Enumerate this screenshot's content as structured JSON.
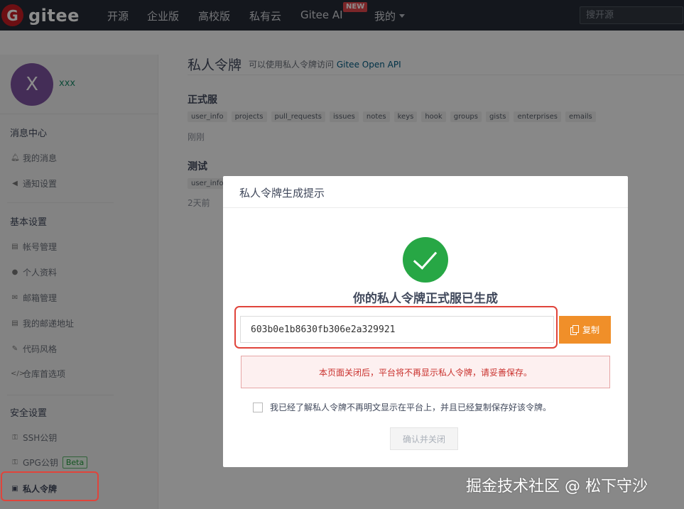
{
  "app": {
    "logo_letter": "G",
    "logo_text": "gitee",
    "brand_color": "#c71d23"
  },
  "nav": {
    "items": [
      "开源",
      "企业版",
      "高校版",
      "私有云",
      "Gitee AI",
      "我的"
    ],
    "new_badge": "NEW",
    "search_placeholder": "搜开源"
  },
  "sidebar": {
    "avatar_letter": "X",
    "username": "xxx",
    "sections": [
      {
        "heading": "消息中心",
        "items": [
          {
            "label": "我的消息",
            "icon": "bell-icon"
          },
          {
            "label": "通知设置",
            "icon": "volume-icon"
          }
        ]
      },
      {
        "heading": "基本设置",
        "items": [
          {
            "label": "帐号管理",
            "icon": "id-card-icon"
          },
          {
            "label": "个人资料",
            "icon": "user-icon"
          },
          {
            "label": "邮箱管理",
            "icon": "mail-icon"
          },
          {
            "label": "我的邮递地址",
            "icon": "address-card-icon"
          },
          {
            "label": "代码风格",
            "icon": "brush-icon"
          },
          {
            "label": "仓库首选项",
            "icon": "code-icon"
          }
        ]
      },
      {
        "heading": "安全设置",
        "items": [
          {
            "label": "SSH公钥",
            "icon": "key-icon"
          },
          {
            "label": "GPG公钥",
            "icon": "key-icon",
            "badge": "Beta"
          },
          {
            "label": "私人令牌",
            "icon": "lock-icon",
            "active": true
          }
        ]
      }
    ]
  },
  "main": {
    "title": "私人令牌",
    "desc_prefix": "可以使用私人令牌访问",
    "desc_link": "Gitee Open API",
    "tokens": [
      {
        "name": "正式服",
        "scopes": [
          "user_info",
          "projects",
          "pull_requests",
          "issues",
          "notes",
          "keys",
          "hook",
          "groups",
          "gists",
          "enterprises",
          "emails"
        ],
        "time": "刚刚"
      },
      {
        "name": "测试",
        "scopes": [
          "user_info"
        ],
        "time": "2天前"
      }
    ]
  },
  "modal": {
    "title": "私人令牌生成提示",
    "heading": "你的私人令牌正式服已生成",
    "token_value": "603b0e1b8630fb306e2a329921",
    "copy_label": "复制",
    "warning": "本页面关闭后，平台将不再显示私人令牌，请妥善保存。",
    "ack_label": "我已经了解私人令牌不再明文显示在平台上，并且已经复制保存好该令牌。",
    "confirm_label": "确认并关闭",
    "success_color": "#27a745",
    "copy_color": "#f08f29"
  },
  "watermark": "掘金技术社区 @ 松下守沙"
}
